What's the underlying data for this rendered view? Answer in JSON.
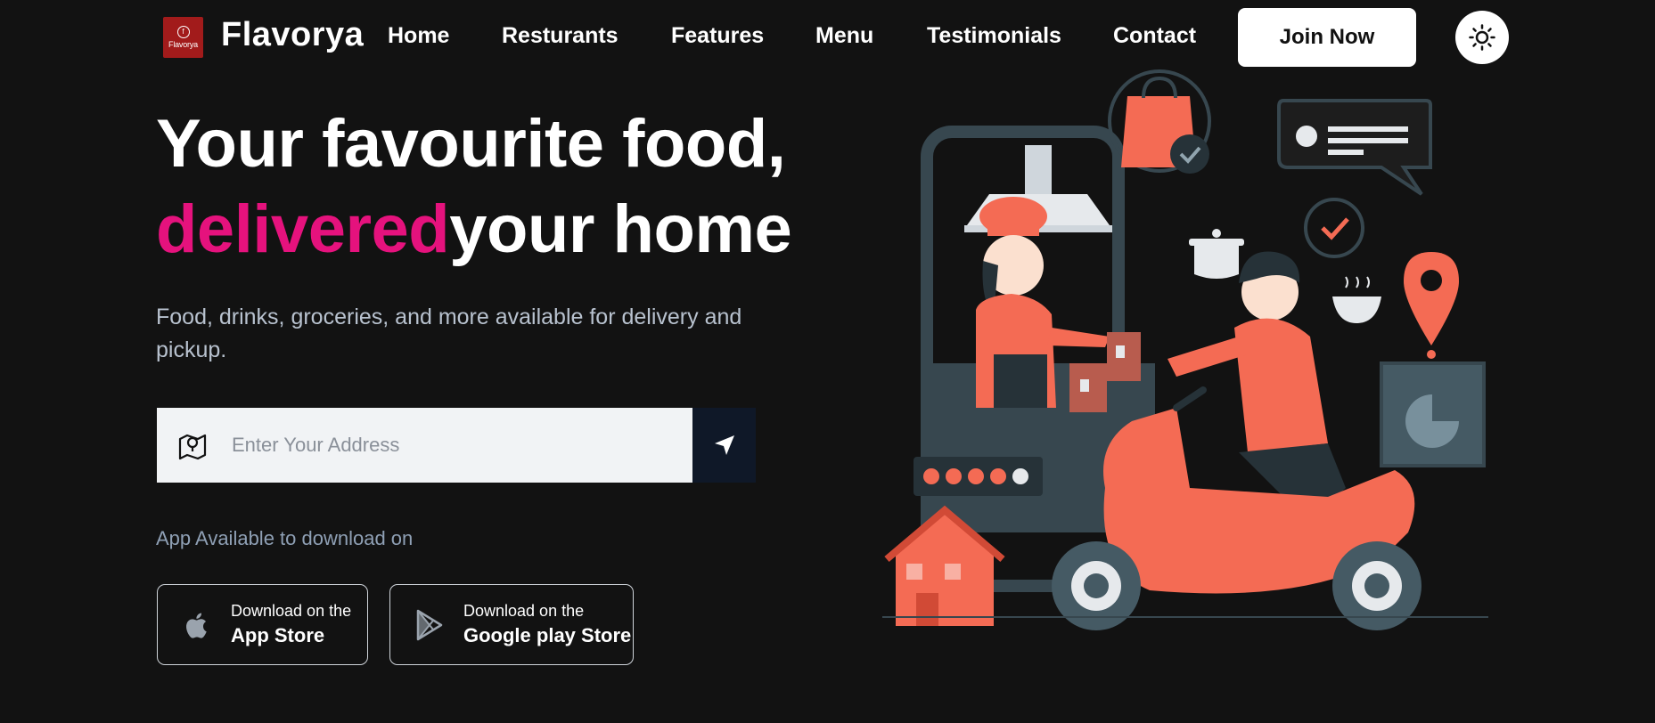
{
  "brand": {
    "logo_text": "Flavorya",
    "name": "Flavorya"
  },
  "nav": {
    "links": [
      "Home",
      "Resturants",
      "Features",
      "Menu",
      "Testimonials",
      "Contact"
    ],
    "join_label": "Join Now"
  },
  "hero": {
    "line1": "Your favourite food,",
    "accent": "delivered",
    "line2_rest": "your home",
    "subtitle": "Food, drinks, groceries, and more available for delivery and pickup."
  },
  "address": {
    "placeholder": "Enter Your Address"
  },
  "apps": {
    "label": "App Available to download on",
    "apple_small": "Download on the",
    "apple_big": "App Store",
    "google_small": "Download on the",
    "google_big": "Google play Store"
  },
  "colors": {
    "background": "#121212",
    "accent": "#e5127d",
    "brand_red": "#a21b1b",
    "illustration": "#f46b54",
    "slate": "#37474f"
  }
}
